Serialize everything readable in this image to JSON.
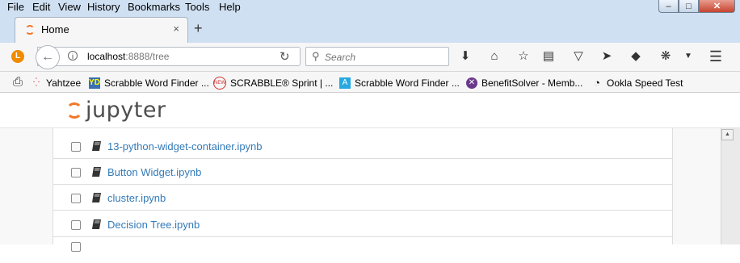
{
  "menubar": {
    "items": [
      {
        "label": "File"
      },
      {
        "label": "Edit"
      },
      {
        "label": "View"
      },
      {
        "label": "History"
      },
      {
        "label": "Bookmarks"
      },
      {
        "label": "Tools"
      },
      {
        "label": "Help"
      }
    ]
  },
  "window_controls": {
    "minimize": "–",
    "maximize": "□",
    "close": "✕"
  },
  "tab": {
    "title": "Home",
    "close": "×"
  },
  "newtab": "+",
  "urlbar": {
    "host": "localhost",
    "rest": ":8888/tree"
  },
  "search": {
    "placeholder": "Search"
  },
  "bookmarks": [
    {
      "label": "Yahtzee"
    },
    {
      "label": "Scrabble Word Finder ..."
    },
    {
      "label": "SCRABBLE® Sprint | ..."
    },
    {
      "label": "Scrabble Word Finder ..."
    },
    {
      "label": "BenefitSolver - Memb..."
    },
    {
      "label": "Ookla Speed Test"
    }
  ],
  "jupyter": {
    "wordmark": "jupyter"
  },
  "files": [
    {
      "name": "13-python-widget-container.ipynb"
    },
    {
      "name": "Button Widget.ipynb"
    },
    {
      "name": "cluster.ipynb"
    },
    {
      "name": "Decision Tree.ipynb"
    },
    {
      "name": ""
    }
  ],
  "colors": {
    "accent": "#f37726",
    "link": "#337ab7",
    "chrome": "#cfe0f2"
  }
}
